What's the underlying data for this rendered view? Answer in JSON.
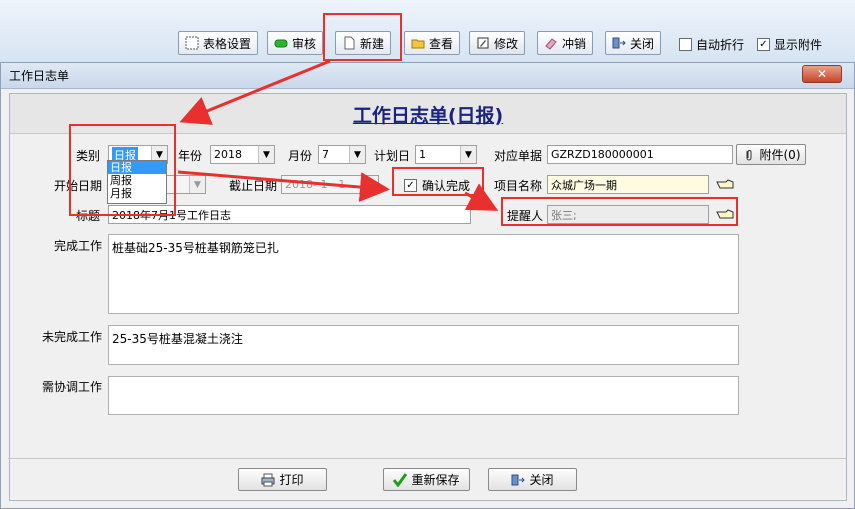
{
  "toolbar": {
    "table_settings": "表格设置",
    "review": "审核",
    "new": "新建",
    "view": "查看",
    "modify": "修改",
    "reverse": "冲销",
    "close": "关闭",
    "auto_wrap": "自动折行",
    "show_attachment": "显示附件",
    "show_attachment_checked": "✓"
  },
  "dialog": {
    "title": "工作日志单",
    "heading": "工作日志单(日报)",
    "close_icon": "✕"
  },
  "form": {
    "category_label": "类别",
    "category_value": "日报",
    "category_options": [
      "日报",
      "周报",
      "月报"
    ],
    "year_label": "年份",
    "year_value": "2018",
    "month_label": "月份",
    "month_value": "7",
    "plan_day_label": "计划日",
    "plan_day_value": "1",
    "doc_label": "对应单据",
    "doc_value": "GZRZD180000001",
    "attachment_button": "附件(0)",
    "start_date_label": "开始日期",
    "end_date_label": "截止日期",
    "end_date_value": "2018- 1 - 1",
    "confirm_label": "确认完成",
    "confirm_checked": "✓",
    "project_label": "项目名称",
    "project_value": "众城广场一期",
    "title_label": "标题",
    "title_value": "2018年7月1号工作日志",
    "reminder_label": "提醒人",
    "reminder_value": "张三;",
    "done_label": "完成工作",
    "done_value": "桩基础25-35号桩基钢筋笼已扎",
    "undone_label": "未完成工作",
    "undone_value": "25-35号桩基混凝土浇注",
    "coord_label": "需协调工作",
    "coord_value": ""
  },
  "footer": {
    "print": "打印",
    "resave": "重新保存",
    "close": "关闭"
  },
  "colors": {
    "highlight": "#e8302f",
    "heading": "#1a237e",
    "project_bg": "#fffbe0"
  }
}
